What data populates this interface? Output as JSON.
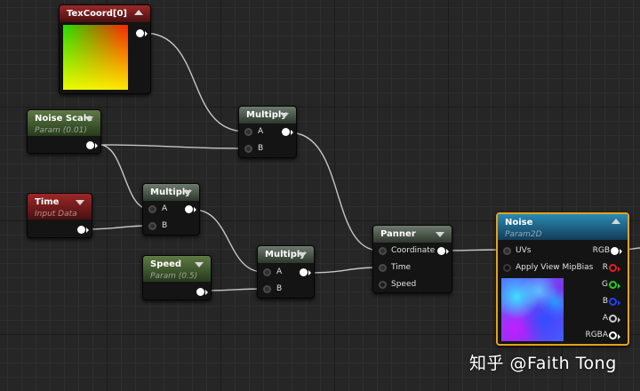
{
  "nodes": {
    "texcoord": {
      "title": "TexCoord[0]"
    },
    "noise_scale": {
      "title": "Noise Scale",
      "subtitle": "Param (0.01)"
    },
    "time": {
      "title": "Time",
      "subtitle": "Input Data"
    },
    "speed": {
      "title": "Speed",
      "subtitle": "Param (0.5)"
    },
    "multiply_1": {
      "title": "Multiply",
      "pin_a": "A",
      "pin_b": "B"
    },
    "multiply_2": {
      "title": "Multiply",
      "pin_a": "A",
      "pin_b": "B"
    },
    "multiply_3": {
      "title": "Multiply",
      "pin_a": "A",
      "pin_b": "B"
    },
    "panner": {
      "title": "Panner",
      "pin_coordinate": "Coordinate",
      "pin_time": "Time",
      "pin_speed": "Speed"
    },
    "noise": {
      "title": "Noise",
      "subtitle": "Param2D",
      "pin_uvs": "UVs",
      "pin_mipbias": "Apply View MipBias",
      "out_rgb": "RGB",
      "out_r": "R",
      "out_g": "G",
      "out_b": "B",
      "out_a": "A",
      "out_rgba": "RGBA"
    }
  },
  "colors": {
    "wire": "#d8d8d8",
    "selection": "#e5a31a",
    "pin_r": "#e02020",
    "pin_g": "#20d020",
    "pin_b": "#2040ff",
    "pin_a": "#cccccc"
  },
  "icons": {
    "collapse": "triangle-icon",
    "pin": "pin-icon"
  },
  "watermark": {
    "text": "知乎 @Faith Tong"
  }
}
